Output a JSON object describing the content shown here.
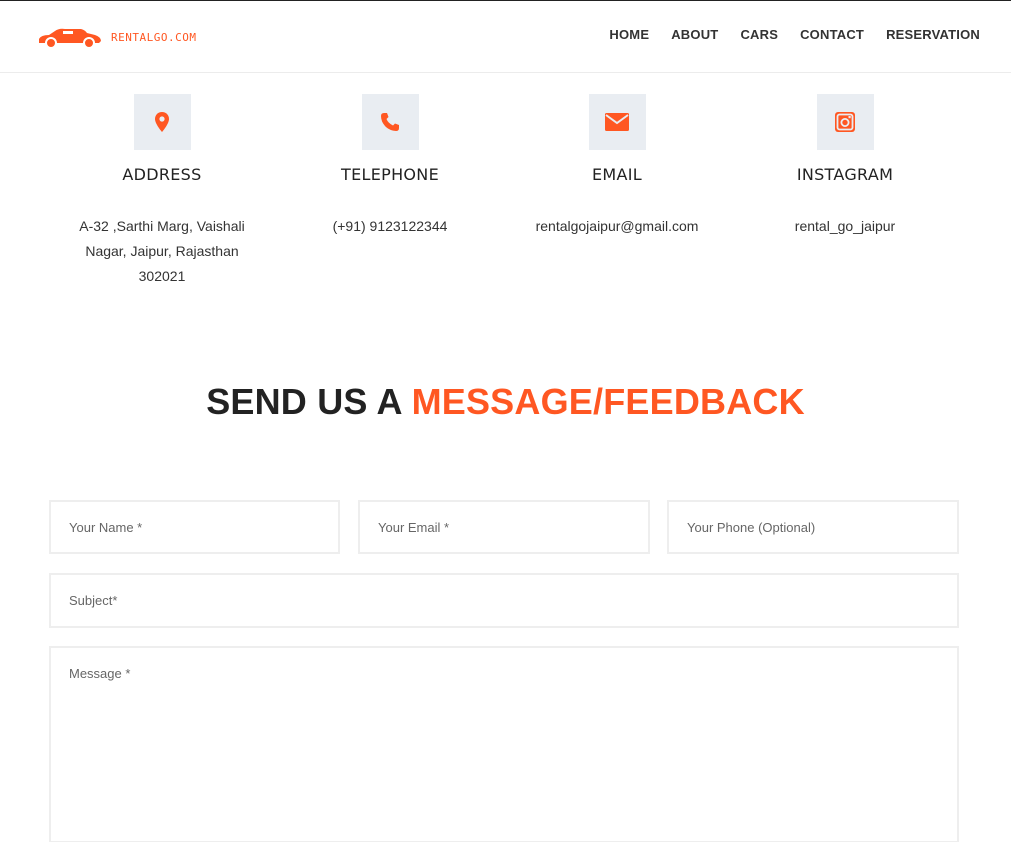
{
  "brand": {
    "logo_text": "RENTALGO.COM",
    "accent_color": "#ff5722"
  },
  "nav": {
    "items": [
      "HOME",
      "ABOUT",
      "CARS",
      "CONTACT",
      "RESERVATION"
    ]
  },
  "contact_info": [
    {
      "icon": "map-pin-icon",
      "title": "ADDRESS",
      "text": "A-32 ,Sarthi Marg, Vaishali Nagar, Jaipur, Rajasthan 302021"
    },
    {
      "icon": "phone-icon",
      "title": "TELEPHONE",
      "text": "(+91) 9123122344"
    },
    {
      "icon": "envelope-icon",
      "title": "EMAIL",
      "text": "rentalgojaipur@gmail.com"
    },
    {
      "icon": "instagram-icon",
      "title": "INSTAGRAM",
      "text": "rental_go_jaipur"
    }
  ],
  "form_section": {
    "heading_dark": "SEND US A",
    "heading_accent": "MESSAGE/FEEDBACK",
    "name_placeholder": "Your Name *",
    "email_placeholder": "Your Email *",
    "phone_placeholder": "Your Phone (Optional)",
    "subject_placeholder": "Subject*",
    "message_placeholder": "Message *"
  }
}
